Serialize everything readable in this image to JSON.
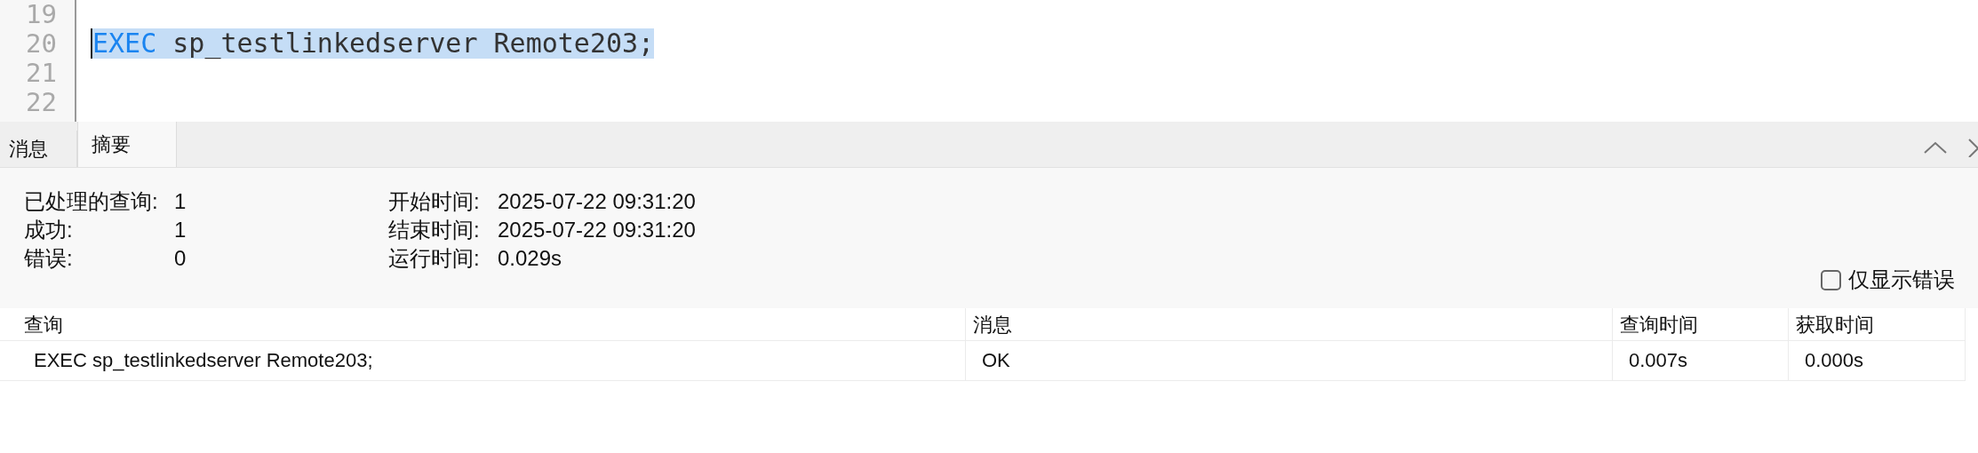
{
  "editor": {
    "lines": [
      {
        "number": "19"
      },
      {
        "number": "20",
        "selected": true,
        "cursor": true,
        "tokens": [
          {
            "kind": "keyword",
            "text": "EXEC"
          },
          {
            "kind": "plain",
            "text": "sp_testlinkedserver Remote203;"
          }
        ]
      },
      {
        "number": "21"
      },
      {
        "number": "22"
      }
    ]
  },
  "tabs": [
    {
      "label": "消息",
      "selected": false
    },
    {
      "label": "摘要",
      "selected": true
    }
  ],
  "summary": {
    "groups": [
      [
        {
          "label": "已处理的查询:",
          "value": "1"
        },
        {
          "label": "成功:",
          "value": "1"
        },
        {
          "label": "错误:",
          "value": "0"
        }
      ],
      [
        {
          "label": "开始时间:",
          "value": "2025-07-22 09:31:20"
        },
        {
          "label": "结束时间:",
          "value": "2025-07-22 09:31:20"
        },
        {
          "label": "运行时间:",
          "value": "0.029s"
        }
      ]
    ],
    "errors_only": {
      "label": "仅显示错误",
      "checked": false
    }
  },
  "table": {
    "columns": [
      "查询",
      "消息",
      "查询时间",
      "获取时间"
    ],
    "rows": [
      [
        "EXEC sp_testlinkedserver Remote203;",
        "OK",
        "0.007s",
        "0.000s"
      ]
    ]
  }
}
